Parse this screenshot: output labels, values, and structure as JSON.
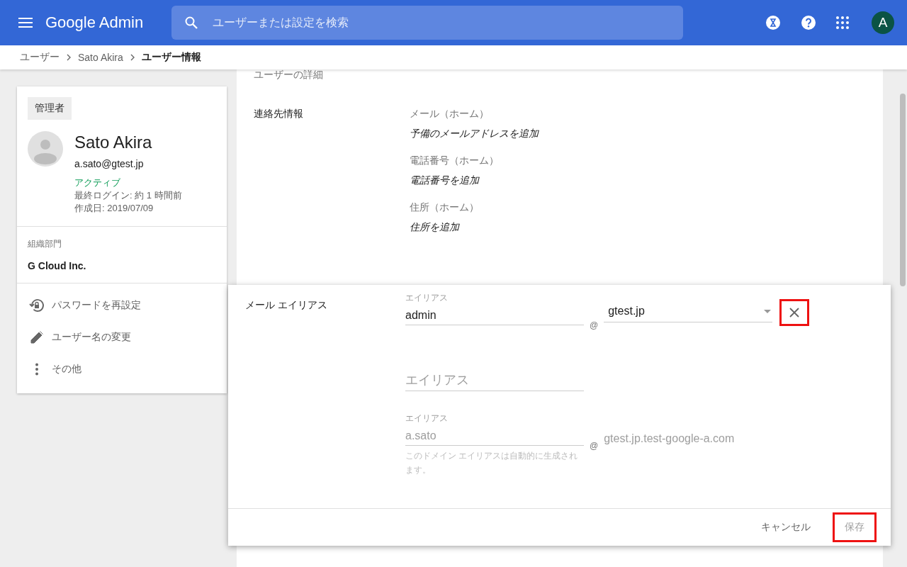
{
  "header": {
    "logo": "Google Admin",
    "search": {
      "placeholder": "ユーザーまたは設定を検索"
    },
    "avatar": "A"
  },
  "breadcrumb": [
    {
      "label": "ユーザー",
      "current": false
    },
    {
      "label": "Sato Akira",
      "current": false
    },
    {
      "label": "ユーザー情報",
      "current": true
    }
  ],
  "profile_card": {
    "badge": "管理者",
    "name": "Sato Akira",
    "email": "a.sato@gtest.jp",
    "status": "アクティブ",
    "last_login": "最終ログイン: 約 1 時間前",
    "created": "作成日: 2019/07/09",
    "org_label": "組織部門",
    "org": "G Cloud Inc.",
    "actions": [
      {
        "kind": "reset",
        "label": "パスワードを再設定"
      },
      {
        "kind": "rename",
        "label": "ユーザー名の変更"
      },
      {
        "kind": "more",
        "label": "その他"
      }
    ]
  },
  "details": {
    "section_title": "ユーザーの詳細",
    "contact_label": "連絡先情報",
    "fields": [
      {
        "label": "メール（ホーム）",
        "value": "予備のメールアドレスを追加"
      },
      {
        "label": "電話番号（ホーム）",
        "value": "電話番号を追加"
      },
      {
        "label": "住所（ホーム）",
        "value": "住所を追加"
      }
    ]
  },
  "alias_editor": {
    "label": "メール エイリアス",
    "aliases": [
      {
        "kind": "editable",
        "label": "エイリアス",
        "value": "admin",
        "separator": "@",
        "domain": "gtest.jp",
        "remove_highlighted": true
      },
      {
        "kind": "empty",
        "placeholder": "エイリアス"
      },
      {
        "kind": "auto",
        "label": "エイリアス",
        "value": "a.sato",
        "separator": "@",
        "domain": "gtest.jp.test-google-a.com",
        "hint": "このドメイン エイリアスは自動的に生成されます。"
      }
    ],
    "cancel": "キャンセル",
    "save": {
      "label": "保存",
      "disabled": true,
      "highlighted": true
    }
  }
}
